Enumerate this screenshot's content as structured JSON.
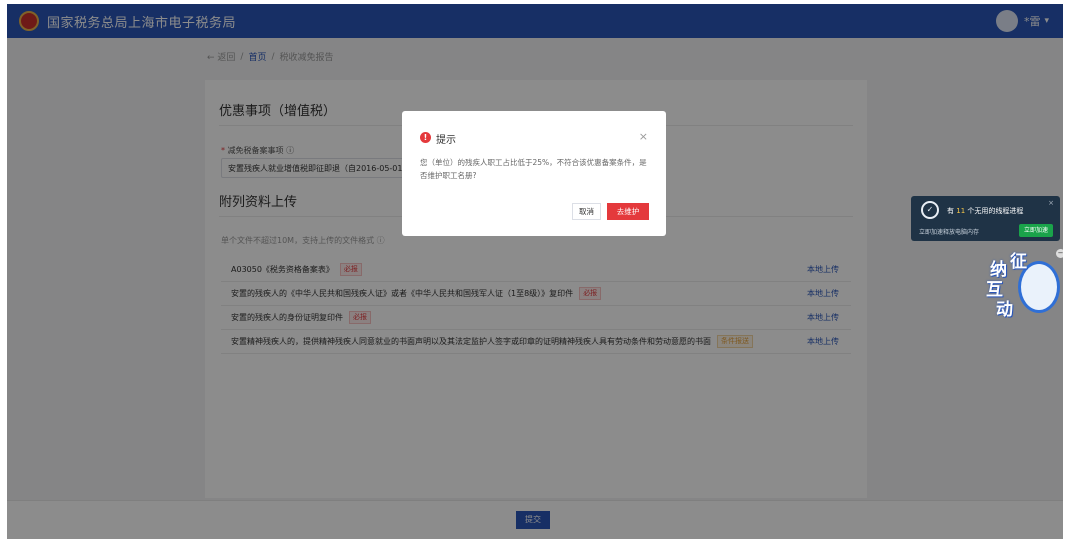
{
  "header": {
    "title": "国家税务总局上海市电子税务局",
    "user_name": "*雷"
  },
  "breadcrumb": {
    "back": "← 返回",
    "home": "首页",
    "sep": "/",
    "current": "税收减免报告"
  },
  "form": {
    "section_title": "优惠事项（增值税）",
    "field_label": "减免税备案事项 ⓘ",
    "field_required": "*",
    "field_value": "安置残疾人就业增值税即征即退（自2016-05-01...",
    "attachments_title": "附列资料上传",
    "attachments_hint": "单个文件不超过10M，支持上传的文件格式 ⓘ",
    "attachments": [
      {
        "name": "A03050《税务资格备案表》",
        "tag": "必报",
        "tag_type": "required",
        "action": "本地上传"
      },
      {
        "name": "安置的残疾人的《中华人民共和国残疾人证》或者《中华人民共和国残军人证（1至8级）》复印件",
        "tag": "必报",
        "tag_type": "required",
        "action": "本地上传"
      },
      {
        "name": "安置的残疾人的身份证明复印件",
        "tag": "必报",
        "tag_type": "required",
        "action": "本地上传"
      },
      {
        "name": "安置精神残疾人的，提供精神残疾人同意就业的书面声明以及其法定监护人签字或印章的证明精神残疾人具有劳动条件和劳动意愿的书面材料",
        "tag": "条件报送",
        "tag_type": "conditional",
        "action": "本地上传"
      }
    ],
    "submit_label": "提交"
  },
  "dialog": {
    "icon": "!",
    "title": "提示",
    "close": "×",
    "message": "您（单位）的残疾人职工占比低于25%，不符合该优惠备案条件，是否维护职工名册?",
    "cancel_label": "取消",
    "confirm_label": "去维护"
  },
  "widget": {
    "text_prefix": "有 ",
    "count": "11",
    "text_suffix": " 个无用的线程进程",
    "close": "×",
    "sub_text": "立即加速释放电脑内存",
    "button_label": "立即加速",
    "collapse": "−"
  },
  "mascot": {
    "chars": [
      "纳",
      "征",
      "互",
      "动"
    ]
  },
  "colors": {
    "brand_blue": "#2a56b8",
    "danger_red": "#e4393c",
    "widget_bg": "#1f3346",
    "widget_green": "#1aa34a"
  }
}
